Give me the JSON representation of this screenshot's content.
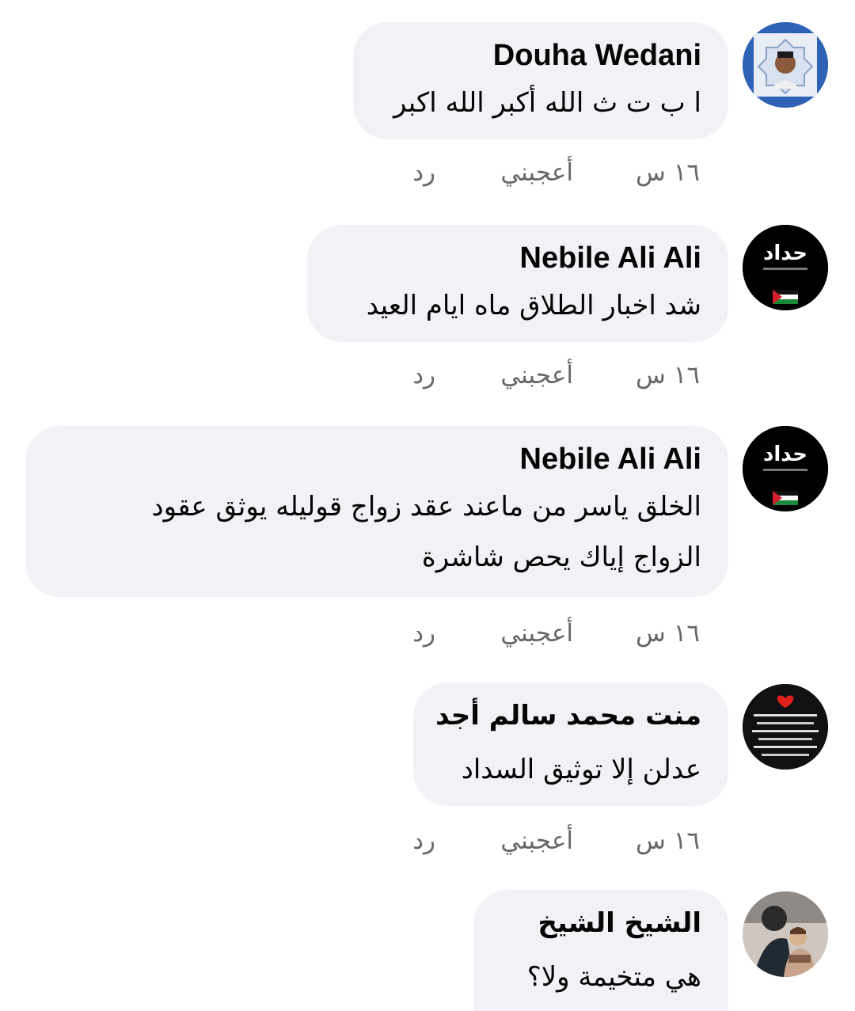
{
  "comments": [
    {
      "author": "Douha Wedani",
      "lines": [
        "ا ب ت ث الله أكبر الله اكبر"
      ],
      "time": "١٦ س",
      "like": "أعجبني",
      "reply": "رد"
    },
    {
      "author": "Nebile Ali Ali",
      "lines": [
        "شد اخبار الطلاق ماه ايام العيد"
      ],
      "time": "١٦ س",
      "like": "أعجبني",
      "reply": "رد",
      "avatar_text": "حداد"
    },
    {
      "author": "Nebile Ali Ali",
      "lines": [
        "الخلق ياسر من ماعند عقد زواج قوليله يوثق عقود",
        "الزواج إياك يحص شاشرة"
      ],
      "time": "١٦ س",
      "like": "أعجبني",
      "reply": "رد",
      "avatar_text": "حداد"
    },
    {
      "author": "منت محمد سالم أجد",
      "lines": [
        "عدلن إلا توثيق السداد"
      ],
      "time": "١٦ س",
      "like": "أعجبني",
      "reply": "رد"
    },
    {
      "author": "الشيخ الشيخ",
      "lines": [
        "هي متخيمة ولا؟"
      ]
    }
  ],
  "colors": {
    "bubble": "#f0f2f5",
    "meta": "#65676b",
    "text": "#050505"
  },
  "icons": [
    "avatar-douha",
    "avatar-mourning",
    "avatar-mourning",
    "avatar-dua",
    "avatar-photo"
  ]
}
